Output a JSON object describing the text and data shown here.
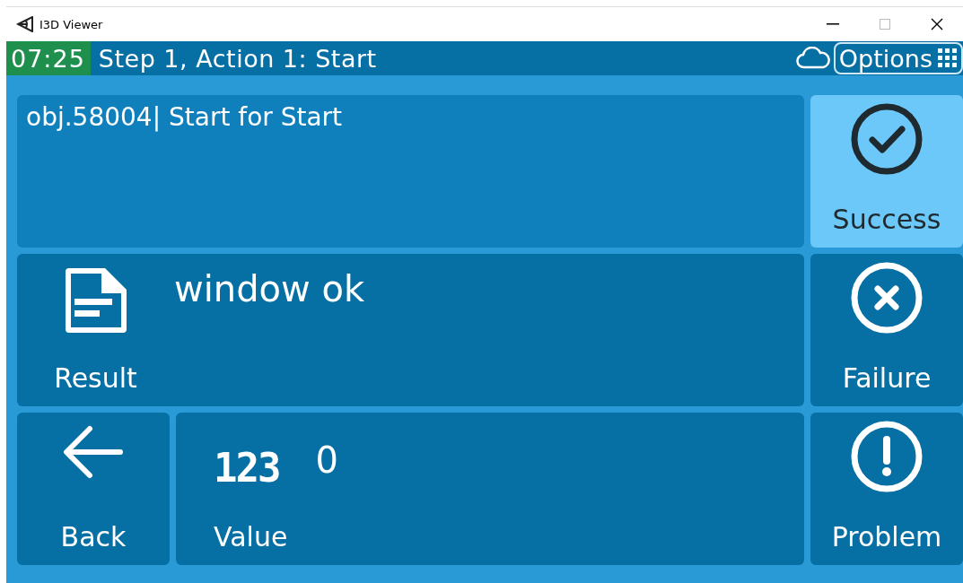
{
  "window": {
    "title": "I3D Viewer"
  },
  "header": {
    "timer": "07:25",
    "title": "Step 1, Action 1: Start",
    "options": "Options"
  },
  "instruction": {
    "text": "obj.58004| Start for Start"
  },
  "result": {
    "label": "Result",
    "text": "window ok"
  },
  "back": {
    "label": "Back"
  },
  "value": {
    "label": "Value",
    "icon_text": "123",
    "text": "0"
  },
  "outcomes": [
    {
      "kind": "success",
      "label": "Success",
      "selected": true
    },
    {
      "kind": "failure",
      "label": "Failure",
      "selected": false
    },
    {
      "kind": "problem",
      "label": "Problem",
      "selected": false
    }
  ]
}
